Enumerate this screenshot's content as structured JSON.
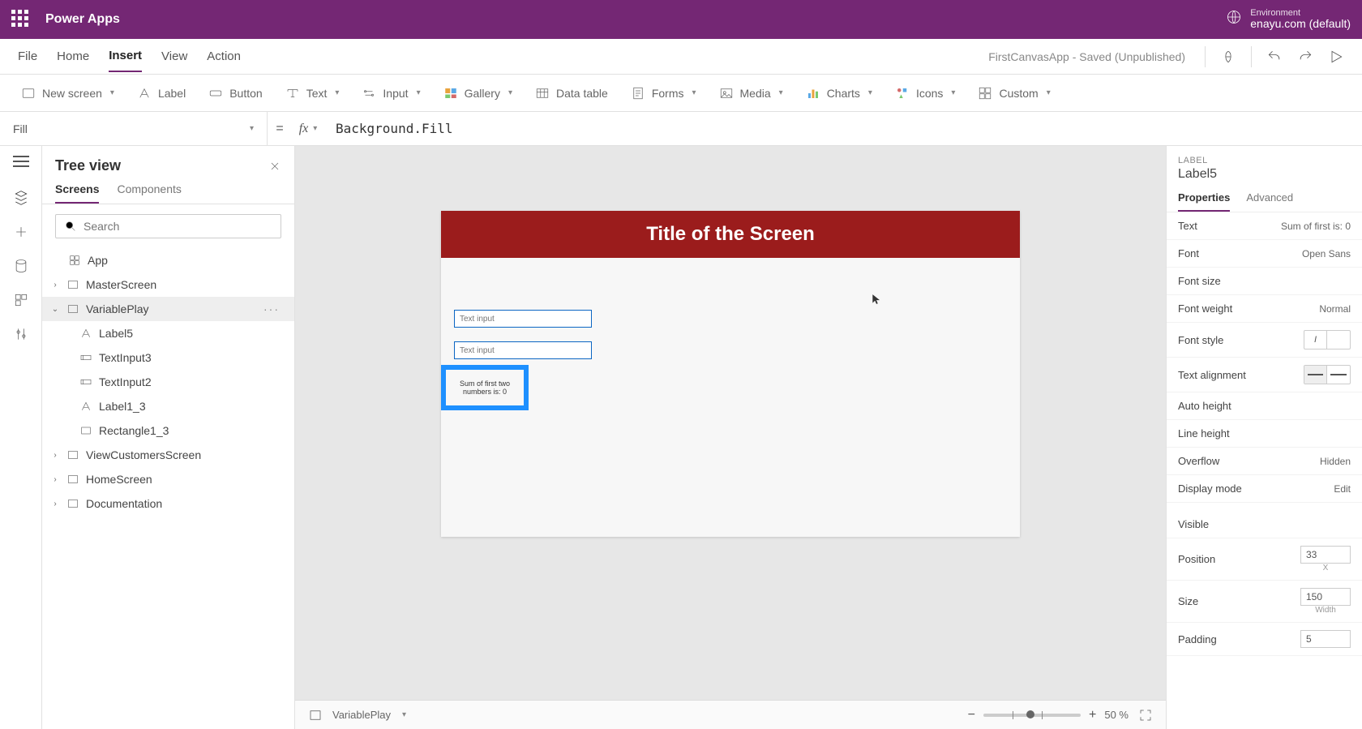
{
  "header": {
    "app_title": "Power Apps",
    "env_label": "Environment",
    "env_name": "enayu.com (default)"
  },
  "menu": {
    "items": [
      "File",
      "Home",
      "Insert",
      "View",
      "Action"
    ],
    "active": "Insert",
    "doc_status": "FirstCanvasApp - Saved (Unpublished)"
  },
  "ribbon": {
    "new_screen": "New screen",
    "label": "Label",
    "button": "Button",
    "text": "Text",
    "input": "Input",
    "gallery": "Gallery",
    "data_table": "Data table",
    "forms": "Forms",
    "media": "Media",
    "charts": "Charts",
    "icons": "Icons",
    "custom": "Custom"
  },
  "formula": {
    "property": "Fill",
    "expression": "Background.Fill"
  },
  "tree": {
    "title": "Tree view",
    "tabs": {
      "screens": "Screens",
      "components": "Components"
    },
    "search_placeholder": "Search",
    "app_label": "App",
    "items": [
      {
        "name": "MasterScreen",
        "expanded": false
      },
      {
        "name": "VariablePlay",
        "expanded": true,
        "selected": true,
        "children": [
          "Label5",
          "TextInput3",
          "TextInput2",
          "Label1_3",
          "Rectangle1_3"
        ]
      },
      {
        "name": "ViewCustomersScreen",
        "expanded": false
      },
      {
        "name": "HomeScreen",
        "expanded": false
      },
      {
        "name": "Documentation",
        "expanded": false
      }
    ]
  },
  "canvas": {
    "title": "Title of the Screen",
    "text_input_placeholder": "Text input",
    "sum_label": "Sum of first two numbers is: 0",
    "footer_screen": "VariablePlay",
    "zoom": "50 %"
  },
  "props": {
    "type": "LABEL",
    "name": "Label5",
    "tabs": {
      "properties": "Properties",
      "advanced": "Advanced"
    },
    "rows": {
      "text": "Text",
      "text_val": "Sum of first is: 0",
      "font": "Font",
      "font_val": "Open Sans",
      "font_size": "Font size",
      "font_weight": "Font weight",
      "font_weight_val": "Normal",
      "font_style": "Font style",
      "text_align": "Text alignment",
      "auto_height": "Auto height",
      "line_height": "Line height",
      "overflow": "Overflow",
      "overflow_val": "Hidden",
      "display_mode": "Display mode",
      "display_mode_val": "Edit",
      "visible": "Visible",
      "position": "Position",
      "position_x": "33",
      "position_x_cap": "X",
      "size": "Size",
      "size_w": "150",
      "size_w_cap": "Width",
      "padding": "Padding",
      "padding_v": "5"
    }
  }
}
